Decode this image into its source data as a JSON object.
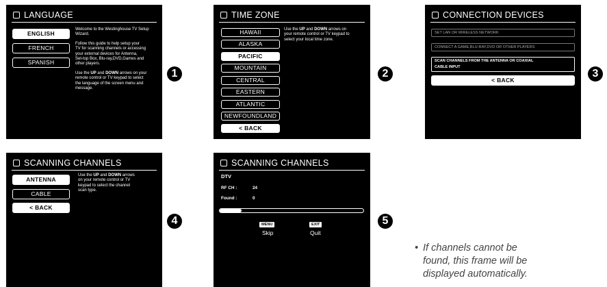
{
  "steps": [
    "1",
    "2",
    "3",
    "4",
    "5"
  ],
  "language": {
    "title": "LANGUAGE",
    "options": [
      "ENGLISH",
      "FRENCH",
      "SPANISH"
    ],
    "selected": "ENGLISH",
    "welcome": [
      "Welcome to the Westinghouse TV Setup",
      "Wizard."
    ],
    "guide": [
      "Follow this guide to help setup your",
      "TV for scanning channels or accessing",
      "your external devices for Antenna,",
      "Set-top Box, Blu-ray,DVD,Games and",
      "other players."
    ],
    "instr_pre": "Use the ",
    "instr_up": "UP",
    "instr_and": " and ",
    "instr_down": "DOWN",
    "instr_post": " arrows on your",
    "instr_rest": [
      "remote control or TV keypad to select",
      "the language of the screen menu and",
      "message."
    ]
  },
  "timezone": {
    "title": "TIME ZONE",
    "options": [
      "HAWAII",
      "ALASKA",
      "PACIFIC",
      "MOUNTAIN",
      "CENTRAL",
      "EASTERN",
      "ATLANTIC",
      "NEWFOUNDLAND"
    ],
    "selected": "PACIFIC",
    "back": "< BACK",
    "instr_pre": "Use the ",
    "instr_up": "UP",
    "instr_and": " and ",
    "instr_down": "DOWN",
    "instr_post": " arrows on",
    "instr_rest": [
      "your remote control or TV keypad to",
      "select your local time zone."
    ]
  },
  "connection": {
    "title": "CONNECTION DEVICES",
    "opt1": "SET LAN OR WIRELESS NETWORK",
    "opt2": "CONNECT A GAME,BLU-RAY,DVD OR OTHER PLAYERS",
    "opt3a": "SCAN CHANNELS FROM THE ANTENNA OR COAXIAL",
    "opt3b": "CABLE INPUT",
    "back": "< BACK"
  },
  "scanning_type": {
    "title": "SCANNING CHANNELS",
    "options": [
      "ANTENNA",
      "CABLE"
    ],
    "selected": "ANTENNA",
    "back": "< BACK",
    "instr_pre": "Use the ",
    "instr_up": "UP",
    "instr_and": " and ",
    "instr_down": "DOWN",
    "instr_post": " arrows",
    "instr_rest": [
      "on your remote control or TV",
      "keypad to select the channel",
      "scan type."
    ]
  },
  "scanning_progress": {
    "title": "SCANNING CHANNELS",
    "mode": "DTV",
    "rf_label": "RF CH :",
    "rf_value": "24",
    "found_label": "Found :",
    "found_value": "0",
    "progress": 0.15,
    "menu_key": "MENU",
    "menu_label": "Skip",
    "exit_key": "EXIT",
    "exit_label": "Quit"
  },
  "note": {
    "bullet": "•",
    "text": [
      "If channels cannot be",
      "found, this frame will be",
      "displayed automatically."
    ]
  }
}
